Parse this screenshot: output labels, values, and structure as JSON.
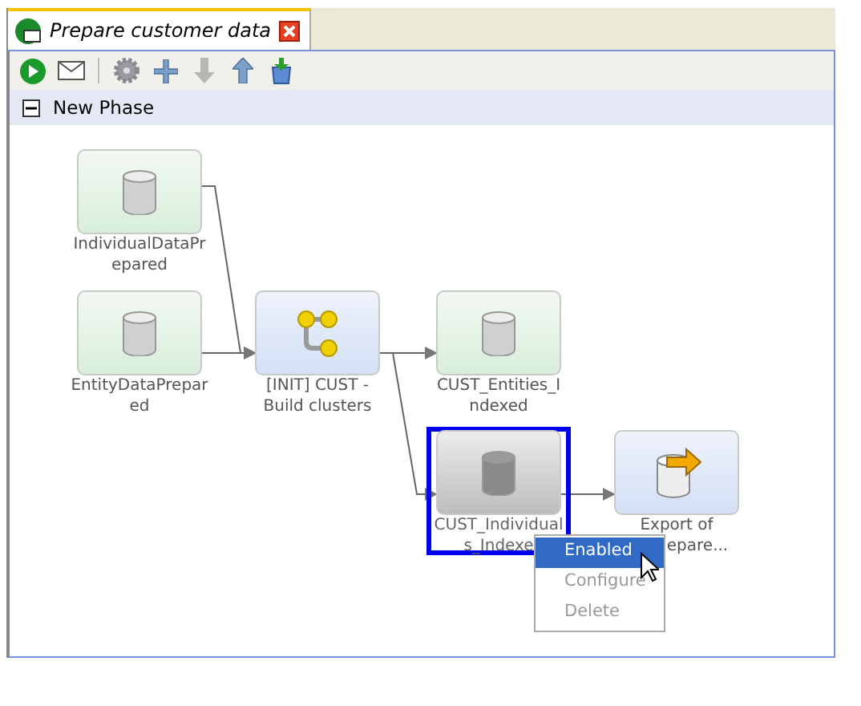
{
  "tab": {
    "title": "Prepare customer data",
    "selected": true
  },
  "toolbar": [
    {
      "kind": "run",
      "disabled": false
    },
    {
      "kind": "mail",
      "disabled": false
    },
    {
      "kind": "settings",
      "disabled": true
    },
    {
      "kind": "add",
      "disabled": false
    },
    {
      "kind": "down",
      "disabled": true
    },
    {
      "kind": "up",
      "disabled": false
    },
    {
      "kind": "export",
      "disabled": false
    }
  ],
  "phase": {
    "title": "New Phase",
    "expanded": true
  },
  "nodes": [
    {
      "kind": "data",
      "label_lines": [
        "IndividualDataPr",
        "epared"
      ],
      "disabled": false,
      "selected": false
    },
    {
      "kind": "data",
      "label_lines": [
        "EntityDataPrepar",
        "ed"
      ],
      "disabled": false,
      "selected": false
    },
    {
      "kind": "process",
      "label_lines": [
        "[INIT] CUST -",
        "Build clusters"
      ],
      "disabled": false,
      "selected": false
    },
    {
      "kind": "data",
      "label_lines": [
        "CUST_Entities_I",
        "ndexed"
      ],
      "disabled": false,
      "selected": false
    },
    {
      "kind": "data",
      "label_lines": [
        "CUST_Individual",
        "s_Indexe"
      ],
      "disabled": true,
      "selected": true
    },
    {
      "kind": "export",
      "label_lines": [
        "Export of",
        "epare..."
      ],
      "disabled": false,
      "selected": false
    }
  ],
  "context_menu": [
    {
      "label": "Enabled",
      "selected": true,
      "disabled": false
    },
    {
      "label": "Configure",
      "selected": false,
      "disabled": true
    },
    {
      "label": "Delete",
      "selected": false,
      "disabled": true
    }
  ]
}
